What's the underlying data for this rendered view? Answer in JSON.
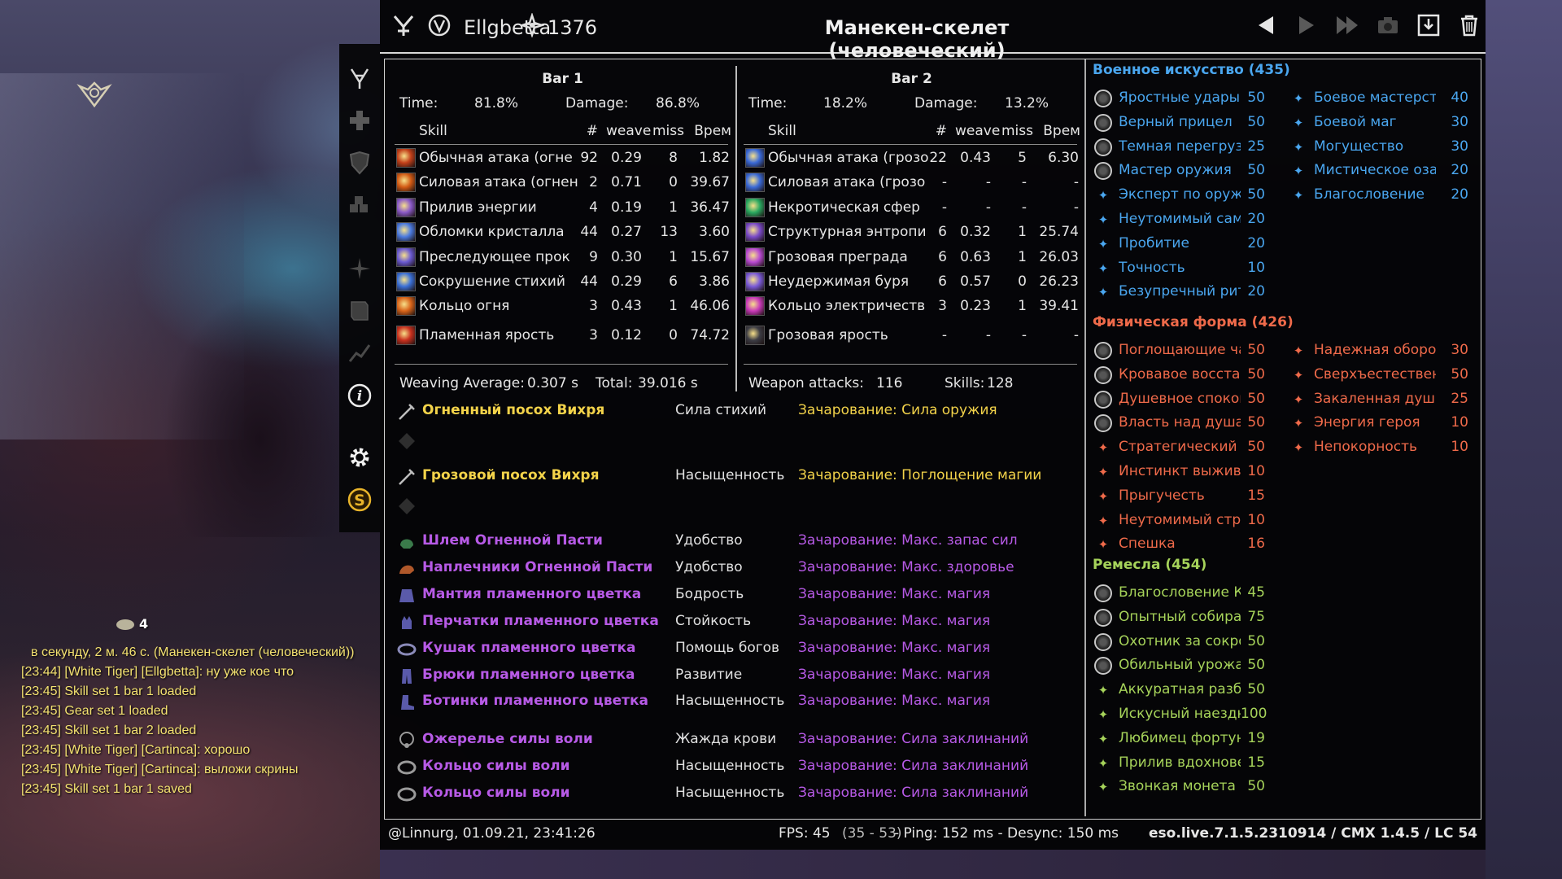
{
  "header": {
    "character_name": "Ellgbetta",
    "champion_points": "1376",
    "fight_title": "Манекен-скелет (человеческий)"
  },
  "bar1": {
    "title": "Bar 1",
    "time_label": "Time:",
    "time_value": "81.8%",
    "damage_label": "Damage:",
    "damage_value": "86.8%",
    "columns": [
      "Skill",
      "#",
      "weave",
      "miss",
      "Врем"
    ],
    "rows": [
      {
        "name": "Обычная атака (огне",
        "count": "92",
        "weave": "0.29",
        "miss": "8",
        "time": "1.82"
      },
      {
        "name": "Силовая атака (огнен",
        "count": "2",
        "weave": "0.71",
        "miss": "0",
        "time": "39.67"
      },
      {
        "name": "Прилив энергии",
        "count": "4",
        "weave": "0.19",
        "miss": "1",
        "time": "36.47"
      },
      {
        "name": "Обломки кристалла",
        "count": "44",
        "weave": "0.27",
        "miss": "13",
        "time": "3.60"
      },
      {
        "name": "Преследующее прок",
        "count": "9",
        "weave": "0.30",
        "miss": "1",
        "time": "15.67"
      },
      {
        "name": "Сокрушение стихий",
        "count": "44",
        "weave": "0.29",
        "miss": "6",
        "time": "3.86"
      },
      {
        "name": "Кольцо огня",
        "count": "3",
        "weave": "0.43",
        "miss": "1",
        "time": "46.06"
      },
      {
        "name": "Пламенная ярость",
        "count": "3",
        "weave": "0.12",
        "miss": "0",
        "time": "74.72"
      }
    ],
    "footer_left_label": "Weaving Average:",
    "footer_left_value": "0.307 s",
    "footer_right_label": "Total:",
    "footer_right_value": "39.016 s"
  },
  "bar2": {
    "title": "Bar 2",
    "time_label": "Time:",
    "time_value": "18.2%",
    "damage_label": "Damage:",
    "damage_value": "13.2%",
    "columns": [
      "Skill",
      "#",
      "weave",
      "miss",
      "Врем"
    ],
    "rows": [
      {
        "name": "Обычная атака (грозо",
        "count": "22",
        "weave": "0.43",
        "miss": "5",
        "time": "6.30"
      },
      {
        "name": "Силовая атака (грозо",
        "count": "-",
        "weave": "-",
        "miss": "-",
        "time": "-"
      },
      {
        "name": "Некротическая сфер",
        "count": "-",
        "weave": "-",
        "miss": "-",
        "time": "-"
      },
      {
        "name": "Структурная энтропи",
        "count": "6",
        "weave": "0.32",
        "miss": "1",
        "time": "25.74"
      },
      {
        "name": "Грозовая преграда",
        "count": "6",
        "weave": "0.63",
        "miss": "1",
        "time": "26.03"
      },
      {
        "name": "Неудержимая буря",
        "count": "6",
        "weave": "0.57",
        "miss": "0",
        "time": "26.23"
      },
      {
        "name": "Кольцо электричеств",
        "count": "3",
        "weave": "0.23",
        "miss": "1",
        "time": "39.41"
      },
      {
        "name": "Грозовая ярость",
        "count": "-",
        "weave": "-",
        "miss": "-",
        "time": "-"
      }
    ],
    "footer_left_label": "Weapon attacks:",
    "footer_left_value": "116",
    "footer_right_label": "Skills:",
    "footer_right_value": "128"
  },
  "gear": [
    {
      "name": "Огненный посох Вихря",
      "trait": "Сила стихий",
      "enchant": "Зачарование: Сила оружия",
      "quality_color": "#f3d34a",
      "icon": "staff-icon"
    },
    {
      "name": "Грозовой посох Вихря",
      "trait": "Насыщенность",
      "enchant": "Зачарование: Поглощение магии",
      "quality_color": "#f3d34a",
      "icon": "staff-icon"
    },
    {
      "name": "Шлем Огненной Пасти",
      "trait": "Удобство",
      "enchant": "Зачарование: Макс. запас сил",
      "quality_color": "#b75ae6",
      "icon": "helmet-icon"
    },
    {
      "name": "Наплечники Огненной Пасти",
      "trait": "Удобство",
      "enchant": "Зачарование: Макс. здоровье",
      "quality_color": "#b75ae6",
      "icon": "shoulder-icon"
    },
    {
      "name": "Мантия пламенного цветка",
      "trait": "Бодрость",
      "enchant": "Зачарование: Макс. магия",
      "quality_color": "#b75ae6",
      "icon": "robe-icon"
    },
    {
      "name": "Перчатки пламенного цветка",
      "trait": "Стойкость",
      "enchant": "Зачарование: Макс. магия",
      "quality_color": "#b75ae6",
      "icon": "gloves-icon"
    },
    {
      "name": "Кушак пламенного цветка",
      "trait": "Помощь богов",
      "enchant": "Зачарование: Макс. магия",
      "quality_color": "#b75ae6",
      "icon": "belt-icon"
    },
    {
      "name": "Брюки пламенного цветка",
      "trait": "Развитие",
      "enchant": "Зачарование: Макс. магия",
      "quality_color": "#b75ae6",
      "icon": "pants-icon"
    },
    {
      "name": "Ботинки пламенного цветка",
      "trait": "Насыщенность",
      "enchant": "Зачарование: Макс. магия",
      "quality_color": "#b75ae6",
      "icon": "boots-icon"
    },
    {
      "name": "Ожерелье силы воли",
      "trait": "Жажда крови",
      "enchant": "Зачарование: Сила заклинаний",
      "quality_color": "#b75ae6",
      "icon": "necklace-icon"
    },
    {
      "name": "Кольцо силы воли",
      "trait": "Насыщенность",
      "enchant": "Зачарование: Сила заклинаний",
      "quality_color": "#b75ae6",
      "icon": "ring-icon"
    },
    {
      "name": "Кольцо силы воли",
      "trait": "Насыщенность",
      "enchant": "Зачарование: Сила заклинаний",
      "quality_color": "#b75ae6",
      "icon": "ring-icon"
    }
  ],
  "champion": {
    "groups": [
      {
        "title": "Военное искусство (435)",
        "color": "#4aa6ef",
        "left": [
          {
            "name": "Яростные удары",
            "value": "50",
            "slotted": true
          },
          {
            "name": "Верный прицел",
            "value": "50",
            "slotted": true
          },
          {
            "name": "Темная перегрузк",
            "value": "25",
            "slotted": true
          },
          {
            "name": "Мастер оружия",
            "value": "50",
            "slotted": true
          },
          {
            "name": "Эксперт по оружи",
            "value": "50",
            "slotted": false
          },
          {
            "name": "Неутомимый сам",
            "value": "20",
            "slotted": false
          },
          {
            "name": "Пробитие",
            "value": "20",
            "slotted": false
          },
          {
            "name": "Точность",
            "value": "10",
            "slotted": false
          },
          {
            "name": "Безупречный риту",
            "value": "20",
            "slotted": false
          }
        ],
        "right": [
          {
            "name": "Боевое мастерст",
            "value": "40"
          },
          {
            "name": "Боевой маг",
            "value": "30"
          },
          {
            "name": "Могущество",
            "value": "30"
          },
          {
            "name": "Мистическое оза",
            "value": "20"
          },
          {
            "name": "Благословение",
            "value": "20"
          }
        ]
      },
      {
        "title": "Физическая форма (426)",
        "color": "#ef6a4a",
        "left": [
          {
            "name": "Поглощающие ча",
            "value": "50",
            "slotted": true
          },
          {
            "name": "Кровавое восстан",
            "value": "50",
            "slotted": true
          },
          {
            "name": "Душевное спокой",
            "value": "50",
            "slotted": true
          },
          {
            "name": "Власть над душа",
            "value": "50",
            "slotted": true
          },
          {
            "name": "Стратегический з",
            "value": "50",
            "slotted": false
          },
          {
            "name": "Инстинкт выжива",
            "value": "10",
            "slotted": false
          },
          {
            "name": "Прыгучесть",
            "value": "15",
            "slotted": false
          },
          {
            "name": "Неутомимый стра",
            "value": "10",
            "slotted": false
          },
          {
            "name": "Спешка",
            "value": "16",
            "slotted": false
          }
        ],
        "right": [
          {
            "name": "Надежная оборон",
            "value": "30"
          },
          {
            "name": "Сверхъестествен",
            "value": "50"
          },
          {
            "name": "Закаленная душа",
            "value": "25"
          },
          {
            "name": "Энергия героя",
            "value": "10"
          },
          {
            "name": "Непокорность",
            "value": "10"
          }
        ]
      },
      {
        "title": "Ремесла (454)",
        "color": "#a6d35a",
        "left": [
          {
            "name": "Благословение К",
            "value": "45",
            "slotted": true
          },
          {
            "name": "Опытный собират",
            "value": "75",
            "slotted": true
          },
          {
            "name": "Охотник за сокро",
            "value": "50",
            "slotted": true
          },
          {
            "name": "Обильный урожай",
            "value": "50",
            "slotted": true
          },
          {
            "name": "Аккуратная разбо",
            "value": "50",
            "slotted": false
          },
          {
            "name": "Искусный наездн",
            "value": "100",
            "slotted": false
          },
          {
            "name": "Любимец фортун",
            "value": "19",
            "slotted": false
          },
          {
            "name": "Прилив вдохнове",
            "value": "15",
            "slotted": false
          },
          {
            "name": "Звонкая монета",
            "value": "50",
            "slotted": false
          }
        ],
        "right": []
      }
    ]
  },
  "status": {
    "left": "@Linnurg, 01.09.21, 23:41:26",
    "fps": "FPS: 45",
    "fps_range": "(35 - 53)",
    "ping": "- Ping: 152 ms - Desync: 150 ms",
    "right": "eso.live.7.1.5.2310914 / CMX 1.4.5 / LC 54"
  },
  "coin_count": "4",
  "chat": [
    {
      "text": "в секунду, 2 м. 46 с. (Манекен-скелет (человеческий))",
      "color": "#f3e170"
    },
    {
      "text": "[23:44] [White Tiger] [Ellgbetta]: ну уже кое что",
      "color": "#f3e170"
    },
    {
      "text": "[23:45] Skill set 1 bar 1 loaded",
      "color": "#f3e170"
    },
    {
      "text": "[23:45] Gear set 1 loaded",
      "color": "#f3e170"
    },
    {
      "text": "[23:45] Skill set 1 bar 2 loaded",
      "color": "#f3e170"
    },
    {
      "text": "[23:45] [White Tiger] [Cartinca]: хорошо",
      "color": "#f3e170"
    },
    {
      "text": "[23:45] [White Tiger] [Cartinca]: выложи скрины",
      "color": "#f3e170"
    },
    {
      "text": "[23:45] Skill set 1 bar 1 saved",
      "color": "#f3e170"
    }
  ],
  "icons": {
    "menu": [
      "weapons-icon",
      "heal-icon",
      "shield-icon",
      "blocks-icon",
      "star-burst-icon",
      "book-icon",
      "graph-icon",
      "info-icon",
      "settings-icon",
      "cmx-logo-icon"
    ],
    "titlebar": [
      "sword-emblem-icon",
      "alliance-icon",
      "champion-icon",
      "previous-icon",
      "next-icon",
      "last-icon",
      "screenshot-icon",
      "save-icon",
      "delete-icon"
    ]
  }
}
